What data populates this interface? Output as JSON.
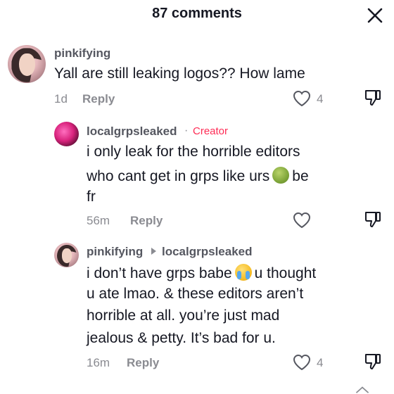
{
  "header": {
    "title": "87 comments"
  },
  "comments": [
    {
      "username": "pinkifying",
      "text": "Yall are still leaking logos?? How lame",
      "time": "1d",
      "reply_label": "Reply",
      "likes": "4",
      "avatar_icon": "user-avatar-photo"
    },
    {
      "username": "localgrpsleaked",
      "creator_dot": "·",
      "creator_label": "Creator",
      "text_line1": "i only leak for the horrible editors",
      "text_line2a": "who cant get in grps like urs",
      "emoji": "nauseated-face",
      "text_line2b": "be",
      "text_line3": "fr",
      "time": "56m",
      "reply_label": "Reply",
      "avatar_icon": "user-avatar-photo"
    },
    {
      "username": "pinkifying",
      "reply_to": "localgrpsleaked",
      "text_line1a": "i don’t have grps babe",
      "emoji": "loudly-crying-face",
      "text_line1b": "u thought",
      "text_line2": "u ate lmao. & these editors aren’t",
      "text_line3": "horrible at all. you’re just mad",
      "text_line4": "jealous & petty. It’s bad for u.",
      "time": "16m",
      "reply_label": "Reply",
      "likes": "4",
      "avatar_icon": "user-avatar-photo"
    }
  ],
  "colors": {
    "creator": "#fe2c55",
    "muted": "#8a8b91",
    "text": "#161823"
  }
}
